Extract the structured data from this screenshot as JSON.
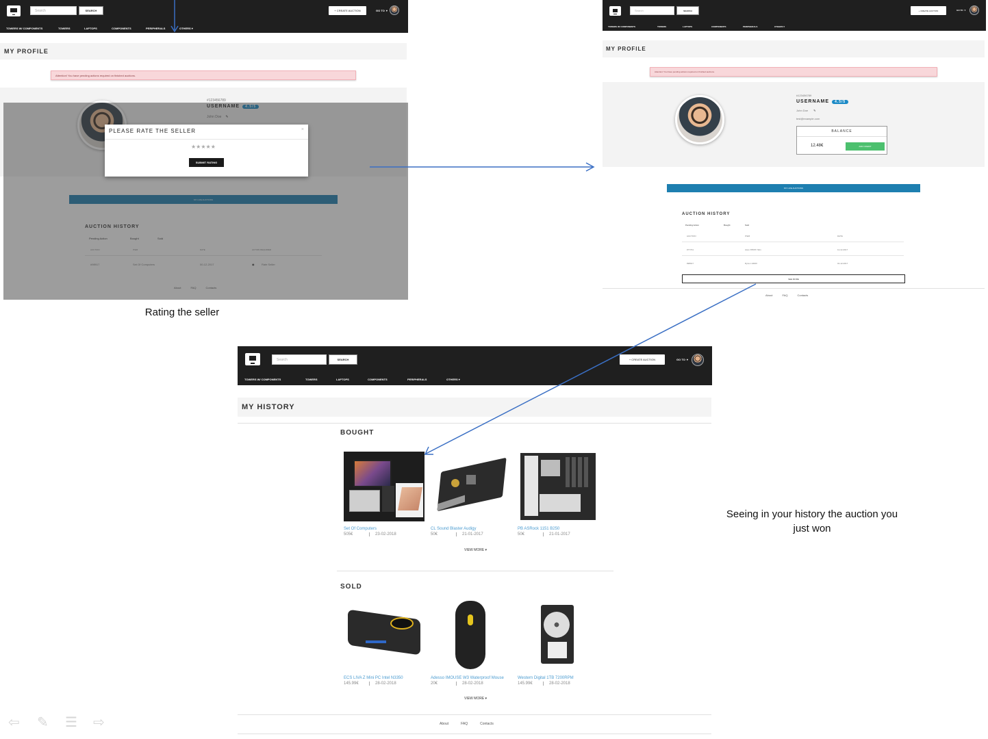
{
  "nav": {
    "search_placeholder": "Search",
    "search_button": "SEARCH",
    "create_auction": "+ CREATE AUCTION",
    "goto": "GO TO",
    "categories": [
      "TOWERS W/ COMPONENTS",
      "TOWERS",
      "LAPTOPS",
      "COMPONENTS",
      "PERIPHERALS",
      "OTHERS ▾"
    ]
  },
  "panel1": {
    "page_title": "MY PROFILE",
    "alert": "Attention! You have pending actions required on finished auctions.",
    "user_id": "#123456789",
    "username": "USERNAME",
    "rating": "4.5/5",
    "real_name": "John Doe",
    "modal_title": "PLEASE RATE THE SELLER",
    "modal_close": "×",
    "submit_rating": "SUBMIT RATING",
    "live_auctions": "MY LIVE AUCTIONS",
    "history_title": "AUCTION HISTORY",
    "tabs": [
      "Pending Action",
      "Bought",
      "Sold"
    ],
    "columns": [
      "AUCTION",
      "ITEM",
      "DATE",
      "ACTION REQUIRED"
    ],
    "row": [
      "#98917",
      "Set Of Computers",
      "00-12-2017",
      "Rate Seller"
    ],
    "footer": [
      "About",
      "FAQ",
      "Contacts"
    ]
  },
  "caption1": "Rating the seller",
  "panel2": {
    "page_title": "MY PROFILE",
    "alert": "Attention! You have pending actions required on finished auctions.",
    "user_id": "#123456789",
    "username": "USERNAME",
    "rating": "4.5/5",
    "real_name": "John Doe",
    "email": "test@example.com",
    "balance_label": "BALANCE",
    "balance_value": "12.48€",
    "add_credit": "ADD CREDIT",
    "live_auctions": "MY LIVE AUCTIONS",
    "history_title": "AUCTION HISTORY",
    "tabs": [
      "Pending Action",
      "Bought",
      "Sold"
    ],
    "columns": [
      "AUCTION",
      "ITEM",
      "DATE"
    ],
    "rows": [
      [
        "#77731",
        "Asus X556T/ Slim",
        "11-12-2017"
      ],
      [
        "#98917",
        "Ryzen 1300X",
        "01-12-2017"
      ]
    ],
    "see_more": "SEE MORE",
    "footer": [
      "About",
      "FAQ",
      "Contacts"
    ]
  },
  "panel3": {
    "page_title": "MY HISTORY",
    "bought_title": "BOUGHT",
    "bought": [
      {
        "name": "Set Of Computers",
        "price": "505€",
        "date": "23-02-2018"
      },
      {
        "name": "CL Sound Blaster Audigy",
        "price": "50€",
        "date": "21-01-2017"
      },
      {
        "name": "PB ASRock 1151 B250",
        "price": "50€",
        "date": "21-01-2017"
      }
    ],
    "view_more": "VIEW MORE ▾",
    "sold_title": "SOLD",
    "sold": [
      {
        "name": "ECS LIVA Z Mini PC Intel N3350",
        "price": "145.99€",
        "date": "28-02-2018"
      },
      {
        "name": "Adesso IMOUSE W3 Waterproof Mouse",
        "price": "20€",
        "date": "28-02-2018"
      },
      {
        "name": "Western Digital 1TB 7200RPM",
        "price": "145.99€",
        "date": "28-02-2018"
      }
    ],
    "footer": [
      "About",
      "FAQ",
      "Contacts"
    ]
  },
  "caption2": "Seeing in your history the auction you just won",
  "colors": {
    "nav_bg": "#1f1f1f",
    "accent_blue": "#1e7fb0",
    "badge_blue": "#1b8ac6",
    "alert_bg": "#f8d7da",
    "credit_green": "#4cc06e",
    "link_blue": "#4a9bd0"
  }
}
